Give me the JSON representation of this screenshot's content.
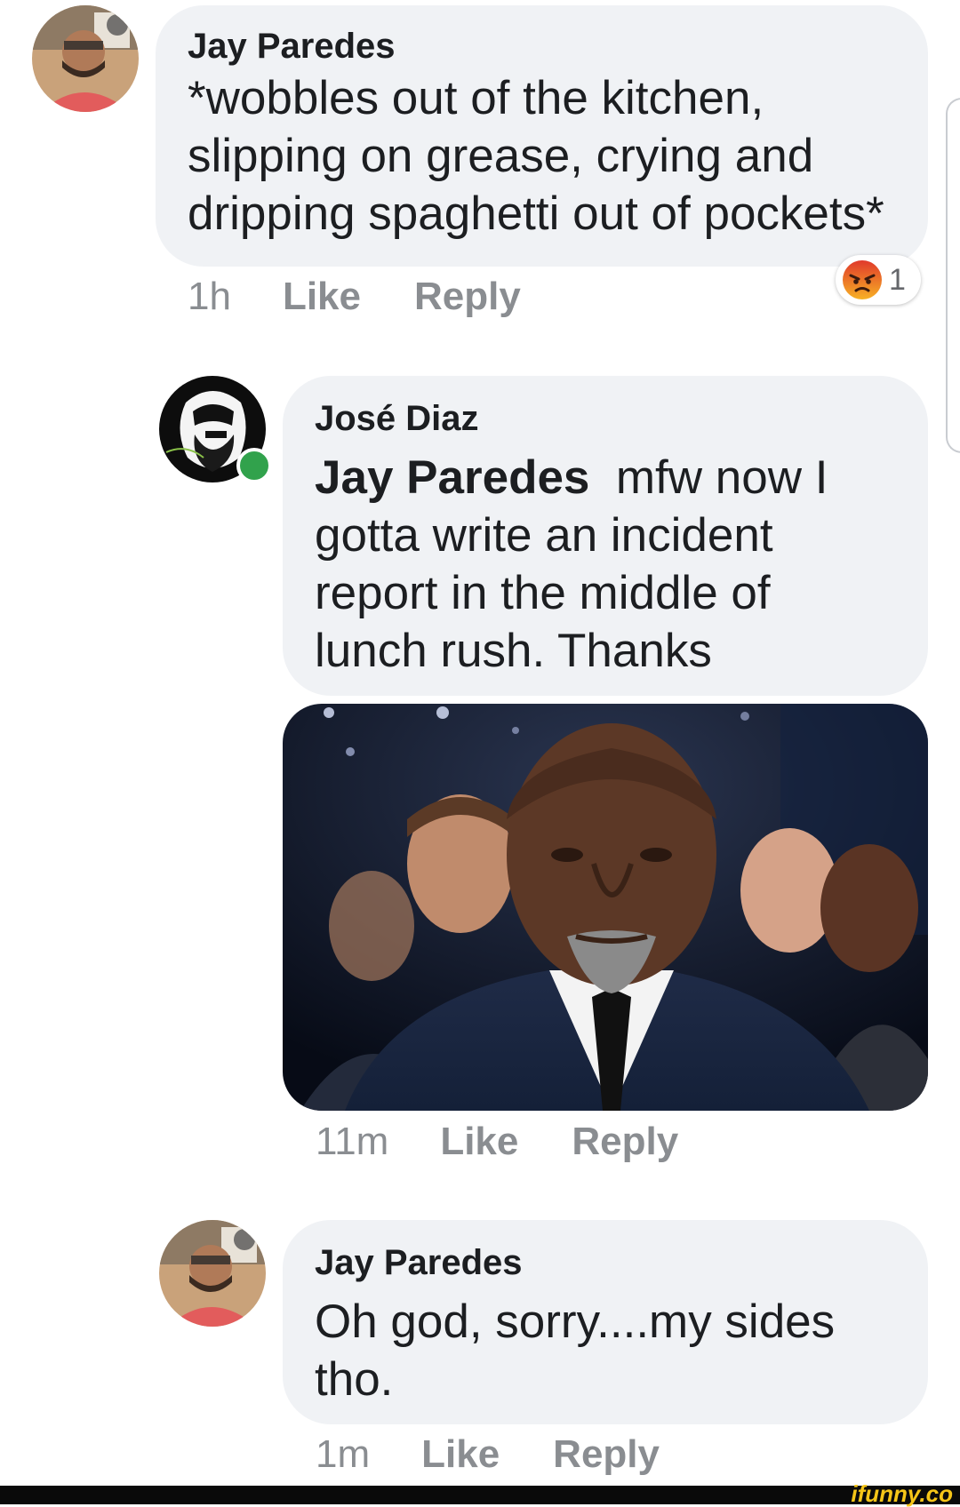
{
  "comments": [
    {
      "author": "Jay Paredes",
      "text": "*wobbles out of the kitchen, slipping on grease, crying and dripping spaghetti out of pockets*",
      "time": "1h",
      "like_label": "Like",
      "reply_label": "Reply",
      "reaction": {
        "icon": "angry-face-icon",
        "count": "1"
      }
    },
    {
      "author": "José Diaz",
      "mention": "Jay Paredes",
      "text": "mfw now I gotta write an incident report in the middle of lunch rush. Thanks",
      "time": "11m",
      "like_label": "Like",
      "reply_label": "Reply",
      "online": true
    },
    {
      "author": "Jay Paredes",
      "text": "Oh god, sorry....my sides tho.",
      "time": "1m",
      "like_label": "Like",
      "reply_label": "Reply"
    }
  ],
  "watermark": "ifunny.co",
  "colors": {
    "bubble": "#f0f2f5",
    "meta_text": "#8a8d91",
    "online": "#31a24c",
    "angry_reaction": "#f46a25"
  }
}
